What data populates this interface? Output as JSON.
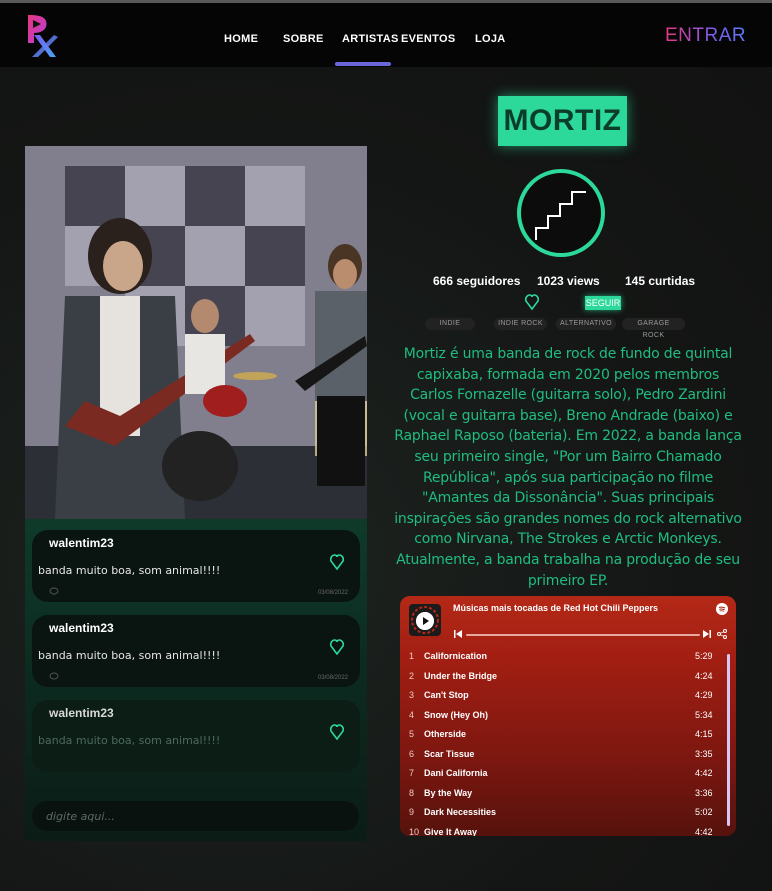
{
  "nav": {
    "items": [
      {
        "label": "HOME"
      },
      {
        "label": "SOBRE"
      },
      {
        "label": "ARTISTAS"
      },
      {
        "label": "EVENTOS"
      },
      {
        "label": "LOJA"
      }
    ],
    "active": "ARTISTAS",
    "login_label": "ENTRAR"
  },
  "artist": {
    "name": "MORTIZ",
    "followers": "666 seguidores",
    "views": "1023 views",
    "likes": "145 curtidas",
    "follow_label": "SEGUIR",
    "tags": [
      "INDIE",
      "INDIE ROCK",
      "ALTERNATIVO",
      "GARAGE ROCK"
    ],
    "bio": "Mortiz é uma banda de rock de fundo de quintal capixaba, formada em 2020 pelos membros Carlos Fornazelle (guitarra solo), Pedro Zardini (vocal e guitarra base), Breno Andrade (baixo) e Raphael Raposo (bateria). Em 2022, a banda lança seu primeiro single, \"Por um Bairro Chamado República\", após sua participação no filme \"Amantes da Dissonância\". Suas principais inspirações são grandes nomes do rock alternativo como Nirvana, The Strokes e Arctic Monkeys. Atualmente, a banda trabalha na produção de seu primeiro EP."
  },
  "comments": [
    {
      "user": "walentim23",
      "text": "banda muito boa, som animal!!!!",
      "date": "03/08/2022"
    },
    {
      "user": "walentim23",
      "text": "banda muito boa, som animal!!!!",
      "date": "03/08/2022"
    },
    {
      "user": "walentim23",
      "text": "banda muito boa, som animal!!!!",
      "date": ""
    }
  ],
  "comment_input": {
    "placeholder": "digite aqui..."
  },
  "spotify": {
    "title": "Músicas mais tocadas de Red Hot Chili Peppers",
    "tracks": [
      {
        "num": "1",
        "name": "Californication",
        "duration": "5:29"
      },
      {
        "num": "2",
        "name": "Under the Bridge",
        "duration": "4:24"
      },
      {
        "num": "3",
        "name": "Can't Stop",
        "duration": "4:29"
      },
      {
        "num": "4",
        "name": "Snow (Hey Oh)",
        "duration": "5:34"
      },
      {
        "num": "5",
        "name": "Otherside",
        "duration": "4:15"
      },
      {
        "num": "6",
        "name": "Scar Tissue",
        "duration": "3:35"
      },
      {
        "num": "7",
        "name": "Dani California",
        "duration": "4:42"
      },
      {
        "num": "8",
        "name": "By the Way",
        "duration": "3:36"
      },
      {
        "num": "9",
        "name": "Dark Necessities",
        "duration": "5:02"
      },
      {
        "num": "10",
        "name": "Give It Away",
        "duration": "4:42"
      }
    ]
  },
  "colors": {
    "accent_green": "#2cd99a",
    "nav_active": "#6a68d8",
    "spotify_red": "#a52114"
  }
}
